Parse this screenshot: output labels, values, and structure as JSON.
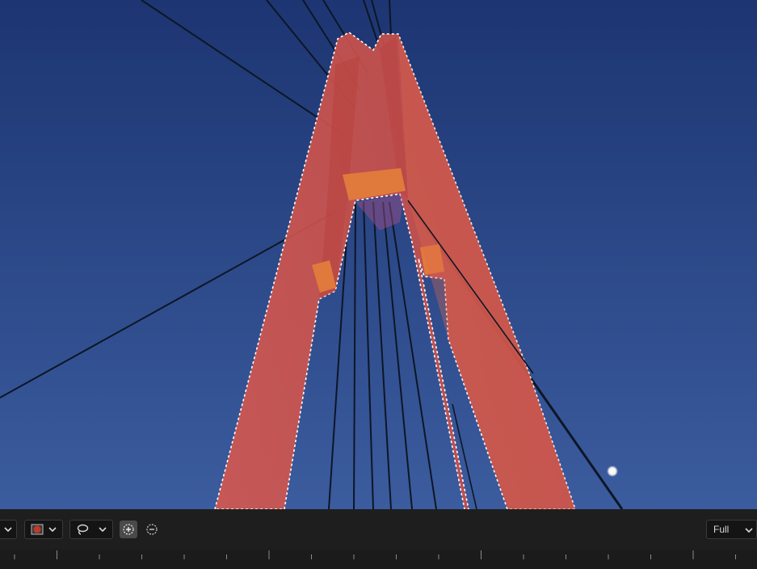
{
  "viewer": {
    "description_icons": [
      "sky-background",
      "bridge-pylon",
      "mask-overlay",
      "moon"
    ],
    "mask_color": "#e0504a",
    "sky_color_top": "#1c3470",
    "sky_color_bottom": "#3a5aa0"
  },
  "toolbar": {
    "color_swatch": "#c0392b",
    "tool_icon": "lasso-icon",
    "add_mode_icon": "add-selection-icon",
    "subtract_mode_icon": "subtract-selection-icon",
    "zoom_value": "Full"
  }
}
